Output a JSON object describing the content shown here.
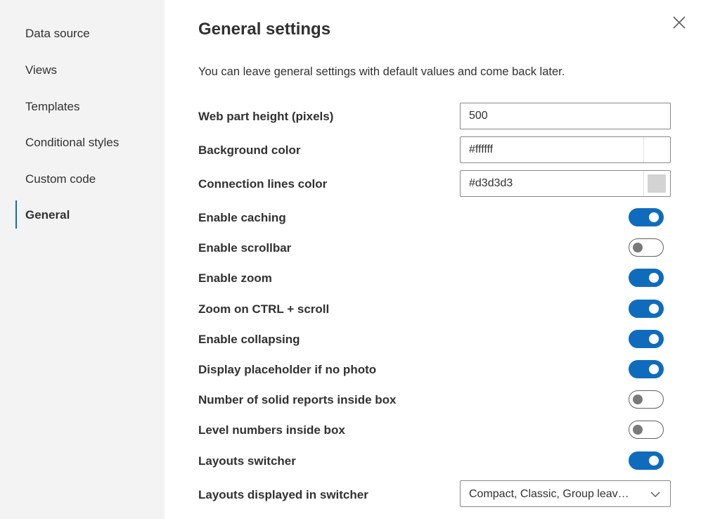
{
  "sidebar": {
    "items": [
      {
        "label": "Data source"
      },
      {
        "label": "Views"
      },
      {
        "label": "Templates"
      },
      {
        "label": "Conditional styles"
      },
      {
        "label": "Custom code"
      },
      {
        "label": "General",
        "active": true
      }
    ]
  },
  "header": {
    "title": "General settings",
    "close_icon": "close-icon"
  },
  "intro": "You can leave general settings with default values and come back later.",
  "fields": {
    "web_part_height": {
      "label": "Web part height (pixels)",
      "value": "500"
    },
    "background_color": {
      "label": "Background color",
      "value": "#ffffff",
      "swatch": "#ffffff"
    },
    "connection_lines_color": {
      "label": "Connection lines color",
      "value": "#d3d3d3",
      "swatch": "#d3d3d3"
    }
  },
  "toggles": [
    {
      "label": "Enable caching",
      "on": true
    },
    {
      "label": "Enable scrollbar",
      "on": false
    },
    {
      "label": "Enable zoom",
      "on": true
    },
    {
      "label": "Zoom on CTRL + scroll",
      "on": true
    },
    {
      "label": "Enable collapsing",
      "on": true
    },
    {
      "label": "Display placeholder if no photo",
      "on": true
    },
    {
      "label": "Number of solid reports inside box",
      "on": false
    },
    {
      "label": "Level numbers inside box",
      "on": false
    },
    {
      "label": "Layouts switcher",
      "on": true
    }
  ],
  "layouts_dropdown": {
    "label": "Layouts displayed in switcher",
    "value": "Compact, Classic, Group leav…",
    "icon": "chevron-down-icon"
  },
  "colors": {
    "accent": "#0f6cbd",
    "sidebar_bg": "#f3f3f3",
    "text": "#323130"
  }
}
